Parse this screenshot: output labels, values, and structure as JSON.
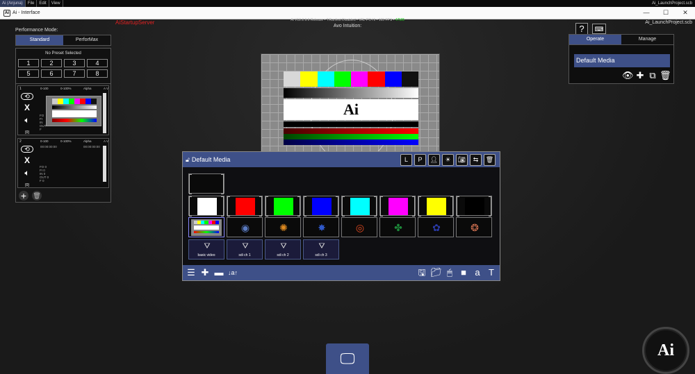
{
  "menubar": {
    "items": [
      "Ai (Anjuna)",
      "File",
      "Edit",
      "View"
    ],
    "project_file": "Ai_LaunchProject.scb"
  },
  "titlebar": {
    "title": "Ai - Interface",
    "controls": [
      "—",
      "☐",
      "✕"
    ]
  },
  "header": {
    "server_name": "AiStartupServer",
    "status_line": "Ai V12.2.9.6 Release  •  T.Ranfest Disabled  •  VAL-PC-Hi  •  165 FPS  •",
    "status_ok": "47MB",
    "avo_label": "Avo Intuition:",
    "project_name": "Ai_LaunchProject.scb"
  },
  "performance": {
    "label": "Performance Mode:",
    "tabs": [
      {
        "label": "Standard",
        "active": true
      },
      {
        "label": "PerforMax",
        "active": false
      }
    ],
    "preset_title": "No Preset Selected",
    "presets": [
      "1",
      "2",
      "3",
      "4",
      "5",
      "6",
      "7",
      "8"
    ]
  },
  "layers": [
    {
      "number": "1",
      "hdr": [
        "0-100",
        "0-100%",
        "Alpha",
        "A V"
      ],
      "time_start": "",
      "time_end": "",
      "info": [
        "FO",
        "FI",
        "IN",
        "OUT",
        "F"
      ],
      "tag": "[0]"
    },
    {
      "number": "2",
      "hdr": [
        "0-100",
        "0-100%",
        "Alpha",
        "A V"
      ],
      "time_start": "00:00:00:00",
      "time_end": "00:00:00:00",
      "info": [
        "FO 0",
        "FI 0",
        "IN 0",
        "OUT 0",
        "F 0"
      ],
      "tag": "[0]"
    }
  ],
  "right_panel": {
    "help": "?",
    "keyboard": "⌨",
    "tabs": [
      {
        "label": "Operate",
        "active": true
      },
      {
        "label": "Manage",
        "active": false
      }
    ],
    "selected_bank": "Default Media"
  },
  "media_bank": {
    "title": "Default Media",
    "color_tiles": [
      {
        "color": "#ffffff"
      },
      {
        "color": "#ff0000"
      },
      {
        "color": "#00ff00"
      },
      {
        "color": "#0000ff"
      },
      {
        "color": "#00ffff"
      },
      {
        "color": "#ff00ff"
      },
      {
        "color": "#ffff00"
      },
      {
        "color": "#000000"
      }
    ],
    "pattern_tiles": [
      {
        "icon": "spiral-blue-icon",
        "glyph": "◉",
        "color": "#5a7ac0"
      },
      {
        "icon": "radiation-orange-icon",
        "glyph": "✺",
        "color": "#e08a20"
      },
      {
        "icon": "blue-star-icon",
        "glyph": "✸",
        "color": "#2f58c8"
      },
      {
        "icon": "red-swirl-icon",
        "glyph": "◎",
        "color": "#e04a20"
      },
      {
        "icon": "green-knot-icon",
        "glyph": "✤",
        "color": "#1d8a3a"
      },
      {
        "icon": "blue-flower-icon",
        "glyph": "✿",
        "color": "#2a3aa8"
      },
      {
        "icon": "orange-spiral-icon",
        "glyph": "❂",
        "color": "#d07050"
      }
    ],
    "video_tiles": [
      {
        "label": "basic video"
      },
      {
        "label": "sdi ch 1"
      },
      {
        "label": "sdi ch 2"
      },
      {
        "label": "sdi ch 3"
      }
    ]
  }
}
